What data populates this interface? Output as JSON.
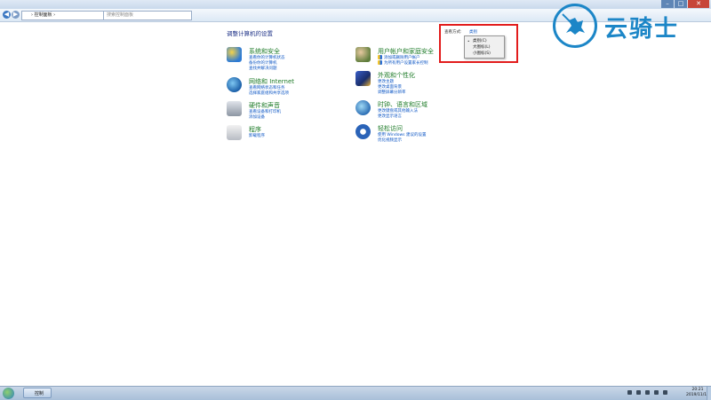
{
  "window": {
    "title": "",
    "controls": {
      "minimize": "–",
      "maximize": "□",
      "close": "✕"
    }
  },
  "nav": {
    "back_glyph": "◀",
    "forward_glyph": "▶",
    "address": "› 控制面板 ›",
    "search_placeholder": "搜索控制面板"
  },
  "main": {
    "heading": "调整计算机的设置",
    "view_by": {
      "label": "查看方式:",
      "value": "类别",
      "menu": {
        "items": [
          {
            "label": "类别(C)",
            "selected": true
          },
          {
            "label": "大图标(L)",
            "selected": false
          },
          {
            "label": "小图标(S)",
            "selected": false
          }
        ],
        "bullet": "•"
      }
    },
    "left_categories": [
      {
        "name": "system-security",
        "title": "系统和安全",
        "links": [
          "查看你的计算机状态",
          "备份你的计算机",
          "查找并解决问题"
        ]
      },
      {
        "name": "network",
        "title": "网络和 Internet",
        "links": [
          "查看网络状态和任务",
          "选择家庭组和共享选项"
        ]
      },
      {
        "name": "hardware-sound",
        "title": "硬件和声音",
        "links": [
          "查看设备和打印机",
          "添加设备"
        ]
      },
      {
        "name": "programs",
        "title": "程序",
        "links": [
          "卸载程序"
        ]
      }
    ],
    "right_categories": [
      {
        "name": "user-accounts",
        "title": "用户帐户和家庭安全",
        "links": [
          "添加或删除用户帐户",
          "为所有用户设置家长控制"
        ]
      },
      {
        "name": "appearance",
        "title": "外观和个性化",
        "links": [
          "更改主题",
          "更改桌面背景",
          "调整屏幕分辨率"
        ]
      },
      {
        "name": "clock-language",
        "title": "时钟、语言和区域",
        "links": [
          "更改键盘或其他输入法",
          "更改显示语言"
        ]
      },
      {
        "name": "ease-of-access",
        "title": "轻松访问",
        "links": [
          "使用 Windows 建议的设置",
          "优化视频显示"
        ]
      }
    ]
  },
  "watermark": {
    "text": "云骑士",
    "color": "#1c86c7"
  },
  "taskbar": {
    "task_label": "控制",
    "time": "20:21",
    "date": "2019/11/18"
  },
  "colors": {
    "link": "#0b55c4",
    "category_title": "#1e7b28",
    "heading": "#1e3287",
    "highlight_box": "#e21c1c"
  }
}
